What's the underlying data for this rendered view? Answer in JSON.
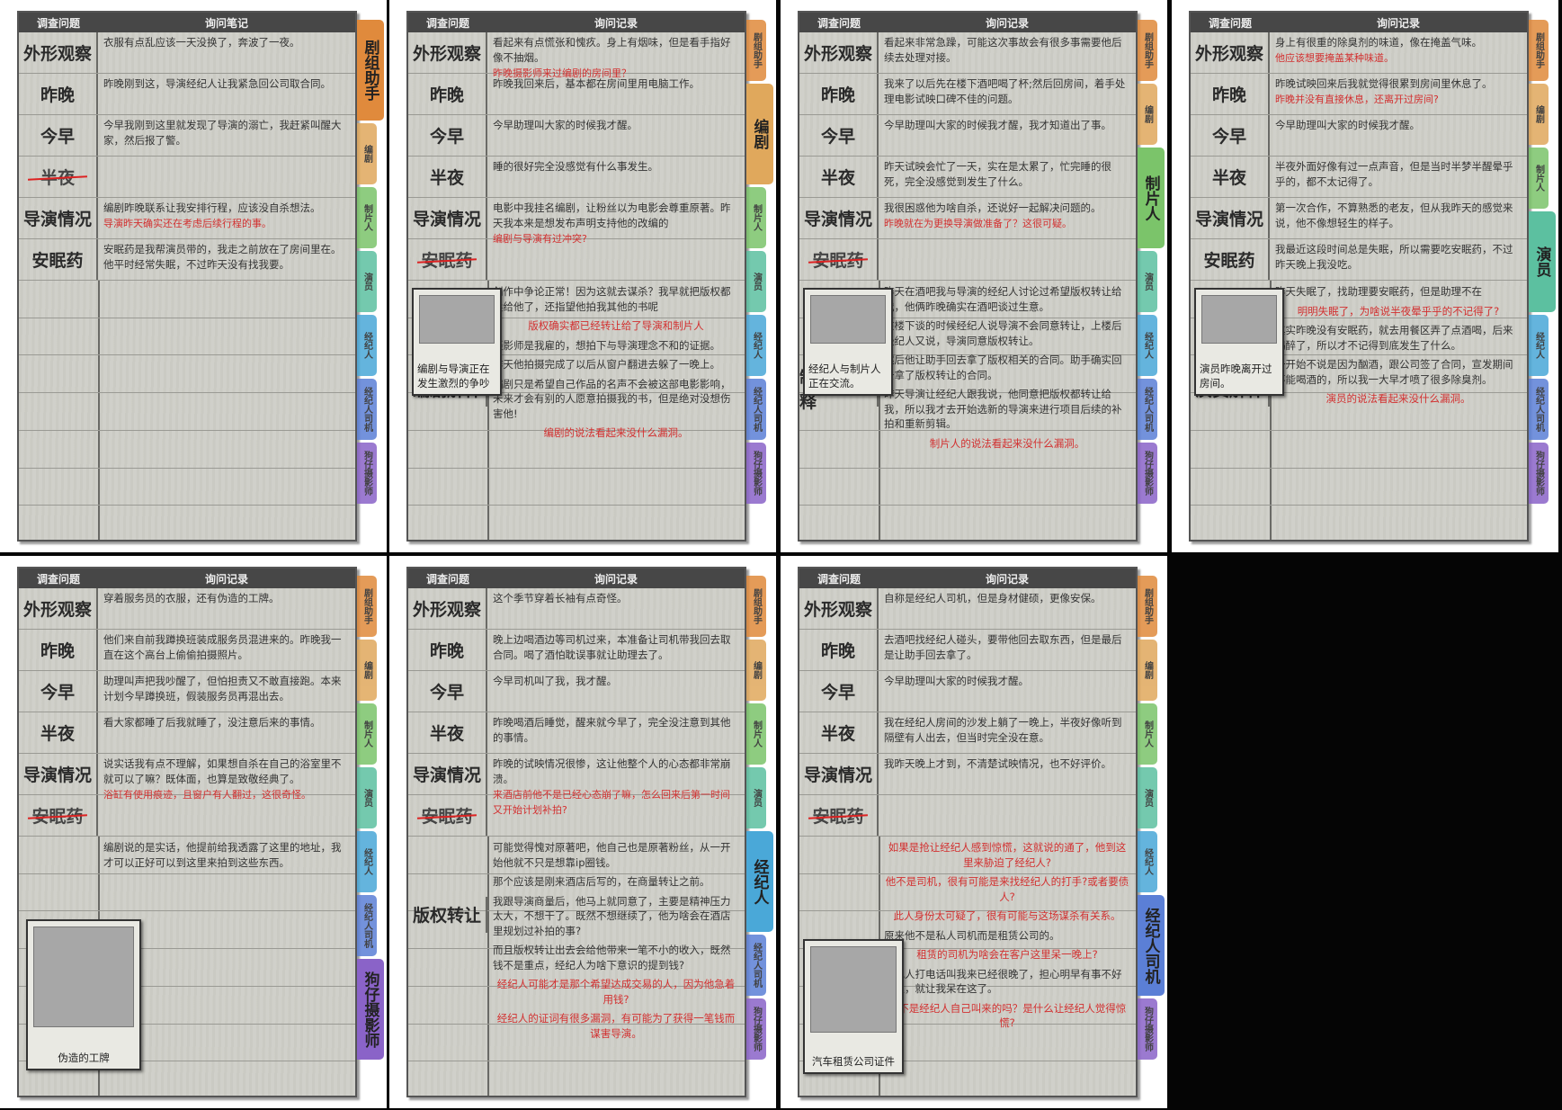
{
  "header": {
    "question": "调查问题",
    "notes_first": "询问笔记",
    "notes": "询问记录"
  },
  "tabs": [
    "剧组助手",
    "编剧",
    "制片人",
    "演员",
    "经纪人",
    "经纪人司机",
    "狗仔摄影师"
  ],
  "tab_colors": [
    "#e08a3c",
    "#e0a85c",
    "#7bc46a",
    "#5cc0a0",
    "#4aa8d8",
    "#5b7fd6",
    "#8a63c8"
  ],
  "questions": [
    "外形观察",
    "昨晚",
    "今早",
    "半夜",
    "导演情况",
    "安眠药"
  ],
  "panels": [
    {
      "id": "assistant",
      "active_tab": 0,
      "notes_header": "first",
      "rows": [
        {
          "q": "外形观察",
          "a": "衣服有点乱应该一天没换了，奔波了一夜。"
        },
        {
          "q": "昨晚",
          "a": "昨晚刚到这，导演经纪人让我紧急回公司取合同。"
        },
        {
          "q": "今早",
          "a": "今早我刚到这里就发现了导演的溺亡，我赶紧叫醒大家，然后报了警。"
        },
        {
          "q": "半夜",
          "a": "",
          "strike": true
        },
        {
          "q": "导演情况",
          "a": "编剧昨晚联系让我安排行程，应该没自杀想法。",
          "note": "导演昨天确实还在考虑后续行程的事。"
        },
        {
          "q": "安眠药",
          "a": "安眠药是我帮演员带的，我走之前放在了房间里在。他平时经常失眠，不过昨天没有找我要。"
        }
      ],
      "extra": []
    },
    {
      "id": "screenwriter",
      "active_tab": 1,
      "rows": [
        {
          "q": "外形观察",
          "a": "看起来有点慌张和愧疚。身上有烟味，但是看手指好像不抽烟。",
          "note": "昨晚摄影师来过编剧的房间里？"
        },
        {
          "q": "昨晚",
          "a": "昨晚我回来后，基本都在房间里用电脑工作。"
        },
        {
          "q": "今早",
          "a": "今早助理叫大家的时候我才醒。"
        },
        {
          "q": "半夜",
          "a": "睡的很好完全没感觉有什么事发生。"
        },
        {
          "q": "导演情况",
          "a": "电影中我挂名编剧，让粉丝以为电影会尊重原著。昨天我本来是想发布声明支持他的改编的",
          "note": "编剧与导演有过冲突?"
        },
        {
          "q": "安眠药",
          "a": "",
          "strike": true
        }
      ],
      "photo": {
        "caption": "编剧与导演正在发生激烈的争吵"
      },
      "explain_q": "编剧解释",
      "extra": [
        {
          "text": "创作中争论正常！因为这就去谋杀？我早就把版权都卖给他了，还指望他拍我其他的书呢",
          "red": false
        },
        {
          "text": "版权确实都已经转让给了导演和制片人",
          "red": true
        },
        {
          "text": "摄影师是我雇的，想拍下与导演理念不和的证据。",
          "red": false
        },
        {
          "text": "昨天他拍摄完成了以后从窗户翻进去躲了一晚上。",
          "red": false
        },
        {
          "text": "编剧只是希望自己作品的名声不会被这部电影影响，未来才会有别的人愿意拍摄我的书，但是绝对没想伤害他!",
          "red": false
        },
        {
          "text": "编剧的说法看起来没什么漏洞。",
          "red": true
        }
      ]
    },
    {
      "id": "producer",
      "active_tab": 2,
      "rows": [
        {
          "q": "外形观察",
          "a": "看起来非常急躁，可能这次事故会有很多事需要他后续去处理对接。"
        },
        {
          "q": "昨晚",
          "a": "我来了以后先在楼下酒吧喝了杯;然后回房间，着手处理电影试映口碑不佳的问题。"
        },
        {
          "q": "今早",
          "a": "今早助理叫大家的时候我才醒，我才知道出了事。"
        },
        {
          "q": "半夜",
          "a": "昨天试映会忙了一天，实在是太累了，忙完睡的很死，完全没感觉到发生了什么。"
        },
        {
          "q": "导演情况",
          "a": "我很困惑他为啥自杀，还说好一起解决问题的。",
          "note": "昨晚就在为更换导演做准备了？这很可疑。"
        },
        {
          "q": "安眠药",
          "a": "",
          "strike": true
        }
      ],
      "photo": {
        "caption": "经纪人与制片人正在交流。"
      },
      "explain_q": "制片人解释",
      "extra": [
        {
          "text": "昨天在酒吧我与导演的经纪人讨论过希望版权转让给我，他俩昨晚确实在酒吧谈过生意。",
          "red": false
        },
        {
          "text": "在楼下谈的时候经纪人说导演不会同意转让，上楼后经纪人又说，导演同意版权转让。",
          "red": false
        },
        {
          "text": "然后他让助手回去拿了版权相关的合同。助手确实回去拿了版权转让的合同。",
          "red": false
        },
        {
          "text": "昨天导演让经纪人跟我说，他同意把版权都转让给我，所以我才去开始选新的导演来进行项目后续的补拍和重新剪辑。",
          "red": false
        },
        {
          "text": "制片人的说法看起来没什么漏洞。",
          "red": true
        }
      ]
    },
    {
      "id": "actor",
      "active_tab": 3,
      "rows": [
        {
          "q": "外形观察",
          "a": "身上有很重的除臭剂的味道，像在掩盖气味。",
          "note": "他应该想要掩盖某种味道。"
        },
        {
          "q": "昨晚",
          "a": "昨晚试映回来后我就觉得很累到房间里休息了。",
          "note": "昨晚并没有直接休息，还离开过房间?"
        },
        {
          "q": "今早",
          "a": "今早助理叫大家的时候我才醒。"
        },
        {
          "q": "半夜",
          "a": "半夜外面好像有过一点声音，但是当时半梦半醒晕乎乎的，都不太记得了。"
        },
        {
          "q": "导演情况",
          "a": "第一次合作，不算熟悉的老友，但从我昨天的感觉来说，他不像想轻生的样子。"
        },
        {
          "q": "安眠药",
          "a": "我最近这段时间总是失眠，所以需要吃安眠药，不过昨天晚上我没吃。"
        }
      ],
      "photo": {
        "caption": "演员昨晚离开过房间。"
      },
      "explain_q": "演员解释",
      "extra": [
        {
          "text": "昨天失眠了，找助理要安眠药，但是助理不在",
          "red": false
        },
        {
          "text": "明明失眠了，为啥说半夜晕乎乎的不记得了?",
          "red": true
        },
        {
          "text": "其实昨晚没有安眠药，就去用餐区弄了点酒喝，后来喝醉了，所以才不记得到底发生了什么。",
          "red": false
        },
        {
          "text": "一开始不说是因为酗酒，跟公司签了合同，宣发期间不能喝酒的，所以我一大早才喷了很多除臭剂。",
          "red": false
        },
        {
          "text": "演员的说法看起来没什么漏洞。",
          "red": true
        }
      ]
    },
    {
      "id": "paparazzi",
      "active_tab": 6,
      "rows": [
        {
          "q": "外形观察",
          "a": "穿着服务员的衣服，还有伪造的工牌。"
        },
        {
          "q": "昨晚",
          "a": "他们来自前我蹲换班装成服务员混进来的。昨晚我一直在这个高台上偷偷拍摄照片。"
        },
        {
          "q": "今早",
          "a": "助理叫声把我吵醒了，但怕担责又不敢直接跑。本来计划今早蹲换班，假装服务员再混出去。"
        },
        {
          "q": "半夜",
          "a": "看大家都睡了后我就睡了，没注意后来的事情。"
        },
        {
          "q": "导演情况",
          "a": "说实话我有点不理解，如果想自杀在自己的浴室里不就可以了嘛？既体面，也算是致敬经典了。",
          "note": "浴缸有使用痕迹，且窗户有人翻过，这很奇怪。"
        },
        {
          "q": "安眠药",
          "a": "",
          "strike": true
        }
      ],
      "photo": {
        "caption": "伪造的工牌"
      },
      "extra": [
        {
          "text": "编剧说的是实话，他提前给我透露了这里的地址，我才可以正好可以到这里来拍到这些东西。",
          "red": false
        }
      ]
    },
    {
      "id": "agent",
      "active_tab": 4,
      "rows": [
        {
          "q": "外形观察",
          "a": "这个季节穿着长袖有点奇怪。"
        },
        {
          "q": "昨晚",
          "a": "晚上边喝酒边等司机过来，本准备让司机带我回去取合同。喝了酒怕耽误事就让助理去了。"
        },
        {
          "q": "今早",
          "a": "今早司机叫了我，我才醒。"
        },
        {
          "q": "半夜",
          "a": "昨晚喝酒后睡觉，醒来就今早了，完全没注意到其他的事情。"
        },
        {
          "q": "导演情况",
          "a": "昨晚的试映情况很惨，这让他整个人的心态都非常崩溃。",
          "note": "来酒店前他不是已经心态崩了嘛，怎么回来后第一时间又开始计划补拍?"
        },
        {
          "q": "安眠药",
          "a": "",
          "strike": true
        }
      ],
      "explain_q": "版权转让",
      "extra": [
        {
          "text": "可能觉得愧对原著吧，他自己也是原著粉丝，从一开始他就不只是想靠ip圈钱。",
          "red": false
        },
        {
          "text": "那个应该是刚来酒店后写的，在商量转让之前。",
          "red": false
        },
        {
          "text": "我跟导演商量后，他马上就同意了，主要是精神压力太大，不想干了。既然不想继续了，他为啥会在酒店里规划过补拍的事?",
          "red": false
        },
        {
          "text": "而且版权转让出去会给他带来一笔不小的收入，既然钱不是重点，经纪人为啥下意识的提到钱?",
          "red": false
        },
        {
          "text": "经纪人可能才是那个希望达成交易的人，因为他急着用钱?",
          "red": true
        },
        {
          "text": "经纪人的证词有很多漏洞，有可能为了获得一笔钱而谋害导演。",
          "red": true
        }
      ]
    },
    {
      "id": "driver",
      "active_tab": 5,
      "rows": [
        {
          "q": "外形观察",
          "a": "自称是经纪人司机，但是身材健硕，更像安保。"
        },
        {
          "q": "昨晚",
          "a": "去酒吧找经纪人碰头，要带他回去取东西，但是最后是让助手回去拿了。"
        },
        {
          "q": "今早",
          "a": "今早助理叫大家的时候我才醒。"
        },
        {
          "q": "半夜",
          "a": "我在经纪人房间的沙发上躺了一晚上，半夜好像听到隔壁有人出去，但当时完全没在意。"
        },
        {
          "q": "导演情况",
          "a": "我昨天晚上才到，不清楚试映情况，也不好评价。"
        },
        {
          "q": "安眠药",
          "a": "",
          "strike": true
        }
      ],
      "photo": {
        "caption": "汽车租赁公司证件"
      },
      "extra": [
        {
          "text": "如果是抢让经纪人感到惊慌，这就说的通了，他到这里来胁迫了经纪人?",
          "red": true
        },
        {
          "text": "他不是司机，很有可能是来找经纪人的打手?或者要债人?",
          "red": true
        },
        {
          "text": "此人身份太可疑了，很有可能与这场谋杀有关系。",
          "red": true
        },
        {
          "text": "原来他不是私人司机而是租赁公司的。",
          "red": false
        },
        {
          "text": "租赁的司机为啥会在客户这里呆一晚上?",
          "red": true
        },
        {
          "text": "经纪人打电话叫我来已经很晚了，担心明早有事不好找人，就让我呆在这了。",
          "red": false
        },
        {
          "text": "他不是经纪人自己叫来的吗？是什么让经纪人觉得惊慌?",
          "red": true
        }
      ]
    }
  ]
}
